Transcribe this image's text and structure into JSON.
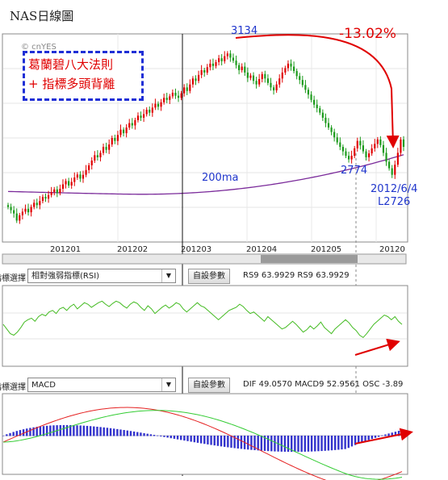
{
  "page": {
    "title": "NAS日線圖"
  },
  "colors": {
    "up": "#e00000",
    "down": "#1a9a1a",
    "ma": "#7a2a9a",
    "rsi": "#44bb22",
    "dif": "#e52222",
    "macd_line": "#33cc33",
    "osc": "#3333cc",
    "annotation": "#e00000",
    "callout": "#1f35cc",
    "box_border": "#1f2fd6"
  },
  "main": {
    "watermark": "© cnYES",
    "annotation_lines": [
      "葛蘭碧八大法則",
      "+ 指標多頭背離"
    ],
    "peak_label": "3134",
    "change_label": "-13.02%",
    "ma_label": "200ma",
    "level_label": "2774",
    "low_date": "2012/6/4",
    "low_value": "L2726",
    "month_labels": [
      "201201",
      "201202",
      "201203",
      "201204",
      "201205",
      "20120"
    ]
  },
  "rsi_panel": {
    "selector_label": "指標選擇",
    "indicator": "相對強弱指標(RSI)",
    "settings": "自設參數",
    "readout": "RS9 63.9929    RS9 63.9929"
  },
  "macd_panel": {
    "selector_label": "指標選擇",
    "indicator": "MACD",
    "settings": "自設參數",
    "readout": "DIF 49.0570    MACD9 52.9561    OSC -3.89"
  },
  "chart_data": [
    {
      "type": "candlestick",
      "x_start": "2011-12-01",
      "x_end": "2012-06-08",
      "ylim": [
        2500,
        3200
      ],
      "closes": [
        2618,
        2607,
        2596,
        2572,
        2590,
        2602,
        2612,
        2600,
        2618,
        2632,
        2624,
        2638,
        2652,
        2646,
        2658,
        2668,
        2677,
        2665,
        2679,
        2694,
        2705,
        2690,
        2702,
        2717,
        2727,
        2713,
        2726,
        2742,
        2758,
        2774,
        2792,
        2785,
        2800,
        2820,
        2810,
        2828,
        2850,
        2840,
        2860,
        2878,
        2866,
        2885,
        2900,
        2892,
        2910,
        2925,
        2918,
        2930,
        2945,
        2935,
        2952,
        2965,
        2955,
        2970,
        2985,
        2978,
        2990,
        3002,
        2992,
        2985,
        3000,
        3020,
        3008,
        3030,
        3050,
        3042,
        3062,
        3078,
        3070,
        3088,
        3100,
        3092,
        3105,
        3118,
        3108,
        3125,
        3134,
        3120,
        3110,
        3095,
        3078,
        3090,
        3070,
        3052,
        3060,
        3042,
        3030,
        3048,
        3065,
        3050,
        3035,
        3020,
        3010,
        3030,
        3050,
        3070,
        3085,
        3100,
        3090,
        3075,
        3058,
        3045,
        3028,
        3012,
        2996,
        2978,
        2962,
        2950,
        2935,
        2918,
        2900,
        2885,
        2870,
        2852,
        2835,
        2820,
        2805,
        2790,
        2778,
        2790,
        2815,
        2840,
        2825,
        2805,
        2785,
        2798,
        2815,
        2830,
        2845,
        2826,
        2800,
        2770,
        2748,
        2726,
        2760,
        2800,
        2845,
        2820
      ],
      "annotations": {
        "high": 3134,
        "pct_change": "-13.02%",
        "support": 2774,
        "low": 2726,
        "low_date": "2012/6/4",
        "ma": "200ma"
      }
    },
    {
      "type": "line",
      "name": "RS9",
      "ylim": [
        0,
        100
      ],
      "last": 63.9929,
      "values": [
        52,
        46,
        40,
        38,
        42,
        48,
        55,
        58,
        60,
        56,
        62,
        65,
        63,
        68,
        70,
        66,
        72,
        74,
        70,
        75,
        78,
        72,
        76,
        80,
        78,
        74,
        77,
        80,
        82,
        78,
        75,
        79,
        82,
        80,
        76,
        73,
        78,
        81,
        79,
        74,
        70,
        76,
        72,
        66,
        70,
        74,
        77,
        73,
        76,
        80,
        78,
        72,
        68,
        72,
        76,
        80,
        76,
        74,
        70,
        66,
        62,
        58,
        62,
        66,
        70,
        72,
        74,
        78,
        75,
        70,
        66,
        68,
        64,
        60,
        56,
        62,
        58,
        54,
        50,
        46,
        48,
        52,
        56,
        52,
        47,
        42,
        45,
        50,
        46,
        50,
        55,
        48,
        44,
        40,
        46,
        50,
        54,
        58,
        54,
        48,
        44,
        38,
        35,
        40,
        46,
        52,
        56,
        60,
        64,
        62,
        58,
        62,
        56,
        52
      ]
    },
    {
      "type": "line",
      "name": "MACD",
      "series": [
        "DIF",
        "MACD9",
        "OSC"
      ],
      "last": {
        "DIF": 49.057,
        "MACD9": 52.9561,
        "OSC": -3.89
      }
    }
  ]
}
